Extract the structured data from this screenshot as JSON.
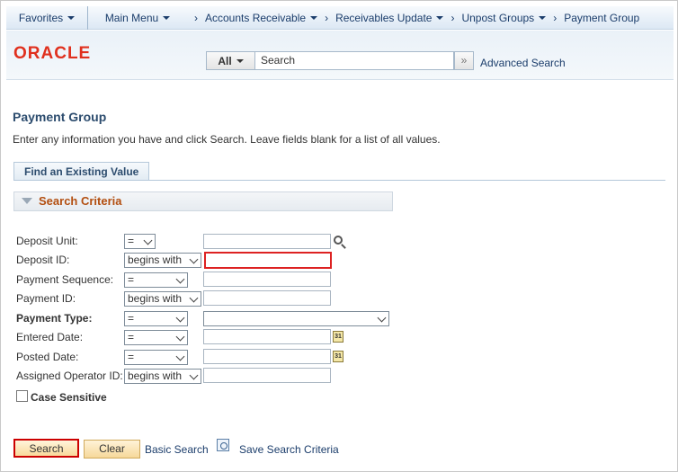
{
  "nav": {
    "favorites": "Favorites",
    "main_menu": "Main Menu",
    "breadcrumb": [
      "Accounts Receivable",
      "Receivables Update",
      "Unpost Groups",
      "Payment Group"
    ]
  },
  "header": {
    "logo": "ORACLE",
    "search_scope": "All",
    "search_placeholder": "Search",
    "go_glyph": "»",
    "advanced_search": "Advanced Search"
  },
  "page": {
    "title": "Payment Group",
    "instructions": "Enter any information you have and click Search. Leave fields blank for a list of all values.",
    "tab": "Find an Existing Value",
    "group_label": "Search Criteria"
  },
  "fields": [
    {
      "label": "Deposit Unit:",
      "operator": "=",
      "value": "",
      "bold": false
    },
    {
      "label": "Deposit ID:",
      "operator": "begins with",
      "value": "",
      "bold": false
    },
    {
      "label": "Payment Sequence:",
      "operator": "=",
      "value": "",
      "bold": false
    },
    {
      "label": "Payment ID:",
      "operator": "begins with",
      "value": "",
      "bold": false
    },
    {
      "label": "Payment Type:",
      "operator": "=",
      "value": "",
      "bold": true
    },
    {
      "label": "Entered Date:",
      "operator": "=",
      "value": "",
      "bold": false
    },
    {
      "label": "Posted Date:",
      "operator": "=",
      "value": "",
      "bold": false
    },
    {
      "label": "Assigned Operator ID:",
      "operator": "begins with",
      "value": "",
      "bold": false
    }
  ],
  "case_sensitive": {
    "label": "Case Sensitive",
    "checked": false
  },
  "calendar_glyph": "31",
  "actions": {
    "search": "Search",
    "clear": "Clear",
    "basic_search": "Basic Search",
    "save_search": "Save Search Criteria"
  },
  "colors": {
    "accent": "#1b3d6b",
    "oracle_red": "#e0301e",
    "section_label": "#b34f11",
    "focus_border": "#dd2222"
  }
}
